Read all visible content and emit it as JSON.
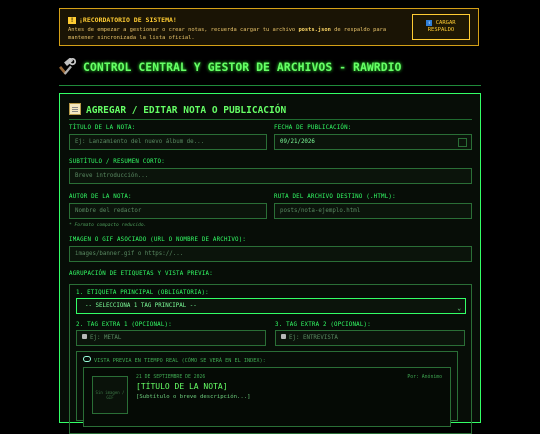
{
  "alert": {
    "title": "¡RECORDATORIO DE SISTEMA!",
    "body_prefix": "Antes de empezar a gestionar o crear notas, recuerda cargar tu archivo ",
    "body_file": "posts.json",
    "body_suffix": " de respaldo para mantener sincronizada la lista oficial.",
    "button_line1": "CARGAR",
    "button_line2": "RESPALDO"
  },
  "header": {
    "title": "CONTROL CENTRAL Y GESTOR DE ARCHIVOS - RAWRDIO"
  },
  "form": {
    "title": "AGREGAR / EDITAR NOTA O PUBLICACIÓN",
    "titulo_label": "TÍTULO DE LA NOTA:",
    "titulo_placeholder": "Ej: Lanzamiento del nuevo álbum de...",
    "fecha_label": "FECHA DE PUBLICACIÓN:",
    "fecha_value": "09/21/2026",
    "subtitulo_label": "SUBTÍTULO / RESUMEN CORTO:",
    "subtitulo_placeholder": "Breve introducción...",
    "autor_label": "AUTOR DE LA NOTA:",
    "autor_placeholder": "Nombre del redactor",
    "ruta_label": "RUTA DEL ARCHIVO DESTINO (.HTML):",
    "ruta_placeholder": "posts/nota-ejemplo.html",
    "ruta_note": "* Formato compacto reducido.",
    "imagen_label": "IMAGEN O GIF ASOCIADO (URL O NOMBRE DE ARCHIVO):",
    "imagen_placeholder": "images/banner.gif o https://...",
    "group_label": "AGRUPACIÓN DE ETIQUETAS Y VISTA PREVIA:"
  },
  "tags": {
    "principal_label": "1. ETIQUETA PRINCIPAL (OBLIGATORIA):",
    "principal_selected": "-- SELECCIONA 1 TAG PRINCIPAL --",
    "extra1_label": "2. TAG EXTRA 1 (OPCIONAL):",
    "extra1_placeholder": "Ej: METAL",
    "extra2_label": "3. TAG EXTRA 2 (OPCIONAL):",
    "extra2_placeholder": "Ej: ENTREVISTA"
  },
  "preview": {
    "header": "VISTA PREVIA EN TIEMPO REAL (CÓMO SE VERÁ EN EL INDEX):",
    "thumb_text": "Sin imagen / GIF",
    "date": "21 DE SEPTIEMBRE DE 2026",
    "author": "Por: Anónimo",
    "title": "[TÍTULO DE LA NOTA]",
    "subtitle": "[Subtítulo o breve descripción...]"
  },
  "icons": {
    "alert": "warning-icon",
    "upload": "upload-icon",
    "tools": "hammer-wrench-icon",
    "memo": "memo-icon",
    "calendar": "calendar-icon",
    "tag": "tag-icon",
    "eye": "eye-icon"
  }
}
